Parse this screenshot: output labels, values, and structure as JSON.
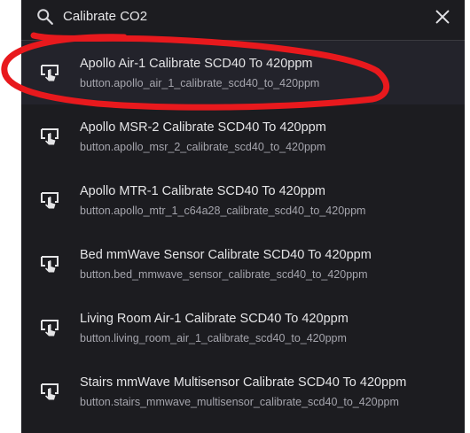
{
  "search": {
    "query": "Calibrate CO2",
    "icon": "search-icon",
    "close_icon": "close-icon"
  },
  "colors": {
    "dialog_bg": "#1c1c20",
    "selected_row_bg": "#23232b",
    "annotation_stroke": "#e8191d"
  },
  "results": [
    {
      "title": "Apollo Air-1 Calibrate SCD40 To 420ppm",
      "entity": "button.apollo_air_1_calibrate_scd40_to_420ppm",
      "icon": "gesture-tap-button-icon"
    },
    {
      "title": "Apollo MSR-2 Calibrate SCD40 To 420ppm",
      "entity": "button.apollo_msr_2_calibrate_scd40_to_420ppm",
      "icon": "gesture-tap-button-icon"
    },
    {
      "title": "Apollo MTR-1 Calibrate SCD40 To 420ppm",
      "entity": "button.apollo_mtr_1_c64a28_calibrate_scd40_to_420ppm",
      "icon": "gesture-tap-button-icon"
    },
    {
      "title": "Bed mmWave Sensor Calibrate SCD40 To 420ppm",
      "entity": "button.bed_mmwave_sensor_calibrate_scd40_to_420ppm",
      "icon": "gesture-tap-button-icon"
    },
    {
      "title": "Living Room Air-1 Calibrate SCD40 To 420ppm",
      "entity": "button.living_room_air_1_calibrate_scd40_to_420ppm",
      "icon": "gesture-tap-button-icon"
    },
    {
      "title": "Stairs mmWave Multisensor Calibrate SCD40 To 420ppm",
      "entity": "button.stairs_mmwave_multisensor_calibrate_scd40_to_420ppm",
      "icon": "gesture-tap-button-icon"
    }
  ]
}
